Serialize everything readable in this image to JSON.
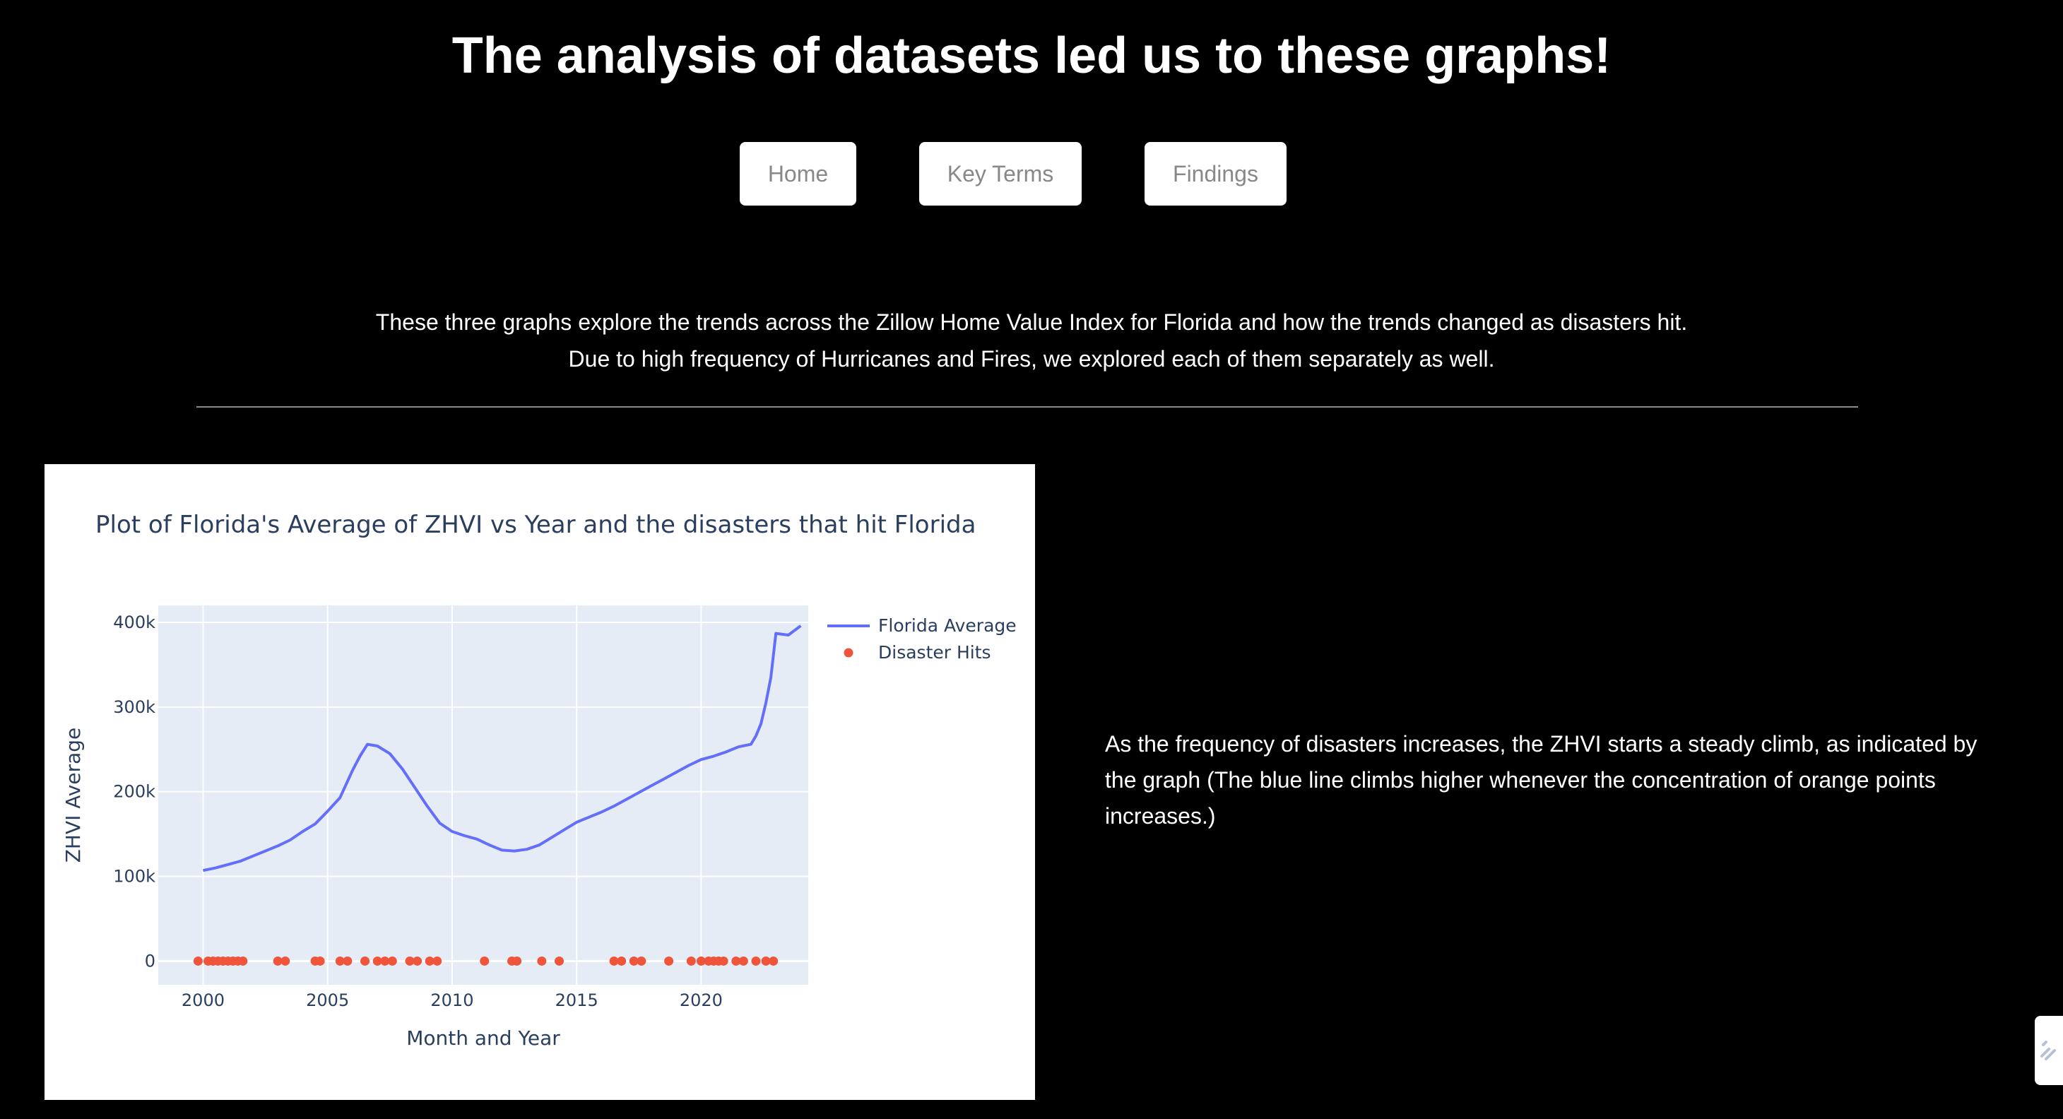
{
  "page": {
    "title": "The analysis of datasets led us to these graphs!",
    "intro_line1": "These three graphs explore the trends across the Zillow Home Value Index for Florida and how the trends changed as disasters hit.",
    "intro_line2": "Due to high frequency of Hurricanes and Fires, we explored each of them separately as well.",
    "side_text": "As the frequency of disasters increases, the ZHVI starts a steady climb, as indicated by the graph (The blue line climbs higher whenever the concentration of orange points increases.)"
  },
  "nav": {
    "home_label": "Home",
    "key_terms_label": "Key Terms",
    "findings_label": "Findings"
  },
  "modebar_icon": "plotly-logo-icon",
  "chart_data": {
    "type": "line",
    "title": "Plot of Florida's Average of ZHVI vs Year and the disasters that hit Florida",
    "xlabel": "Month and Year",
    "ylabel": "ZHVI Average",
    "xlim": [
      1998.2,
      2024.3
    ],
    "ylim": [
      -28000,
      420000
    ],
    "x_ticks": [
      2000,
      2005,
      2010,
      2015,
      2020
    ],
    "x_tick_labels": [
      "2000",
      "2005",
      "2010",
      "2015",
      "2020"
    ],
    "y_ticks": [
      0,
      100000,
      200000,
      300000,
      400000
    ],
    "y_tick_labels": [
      "0",
      "100k",
      "200k",
      "300k",
      "400k"
    ],
    "grid": true,
    "legend_position": "top-right",
    "colors": {
      "line": "#636efa",
      "markers": "#ef553b",
      "plot_bg": "#e5ecf6",
      "text": "#2a3f5f"
    },
    "series": [
      {
        "name": "Florida Average",
        "mode": "lines",
        "x": [
          2000.0,
          2000.5,
          2001.0,
          2001.5,
          2002.0,
          2002.5,
          2003.0,
          2003.5,
          2004.0,
          2004.5,
          2005.0,
          2005.5,
          2006.0,
          2006.3,
          2006.6,
          2007.0,
          2007.5,
          2008.0,
          2008.5,
          2009.0,
          2009.5,
          2010.0,
          2010.5,
          2011.0,
          2011.5,
          2012.0,
          2012.5,
          2013.0,
          2013.5,
          2014.0,
          2014.5,
          2015.0,
          2015.5,
          2016.0,
          2016.5,
          2017.0,
          2017.5,
          2018.0,
          2018.5,
          2019.0,
          2019.5,
          2020.0,
          2020.5,
          2021.0,
          2021.5,
          2022.0,
          2022.2,
          2022.4,
          2022.6,
          2022.8,
          2023.0,
          2023.5,
          2024.0
        ],
        "y": [
          107000,
          110000,
          114000,
          118000,
          124000,
          130000,
          136000,
          143000,
          153000,
          162000,
          177000,
          193000,
          225000,
          242000,
          256000,
          254000,
          245000,
          227000,
          205000,
          183000,
          163000,
          153000,
          148000,
          144000,
          137000,
          131000,
          130000,
          132000,
          137000,
          146000,
          155000,
          164000,
          170000,
          176000,
          183000,
          191000,
          199000,
          207000,
          215000,
          223000,
          231000,
          238000,
          242000,
          247000,
          253000,
          256000,
          266000,
          280000,
          305000,
          335000,
          387000,
          385000,
          396000
        ]
      },
      {
        "name": "Disaster Hits",
        "mode": "markers",
        "x": [
          1999.8,
          2000.2,
          2000.4,
          2000.6,
          2000.8,
          2001.0,
          2001.2,
          2001.4,
          2001.6,
          2003.0,
          2003.3,
          2004.5,
          2004.7,
          2005.5,
          2005.8,
          2006.5,
          2007.0,
          2007.3,
          2007.6,
          2008.3,
          2008.6,
          2009.1,
          2009.4,
          2011.3,
          2012.4,
          2012.6,
          2013.6,
          2014.3,
          2016.5,
          2016.8,
          2017.3,
          2017.6,
          2018.7,
          2019.6,
          2020.0,
          2020.3,
          2020.5,
          2020.7,
          2020.9,
          2021.4,
          2021.7,
          2022.2,
          2022.6,
          2022.9
        ],
        "y": [
          0,
          0,
          0,
          0,
          0,
          0,
          0,
          0,
          0,
          0,
          0,
          0,
          0,
          0,
          0,
          0,
          0,
          0,
          0,
          0,
          0,
          0,
          0,
          0,
          0,
          0,
          0,
          0,
          0,
          0,
          0,
          0,
          0,
          0,
          0,
          0,
          0,
          0,
          0,
          0,
          0,
          0,
          0,
          0
        ]
      }
    ]
  }
}
